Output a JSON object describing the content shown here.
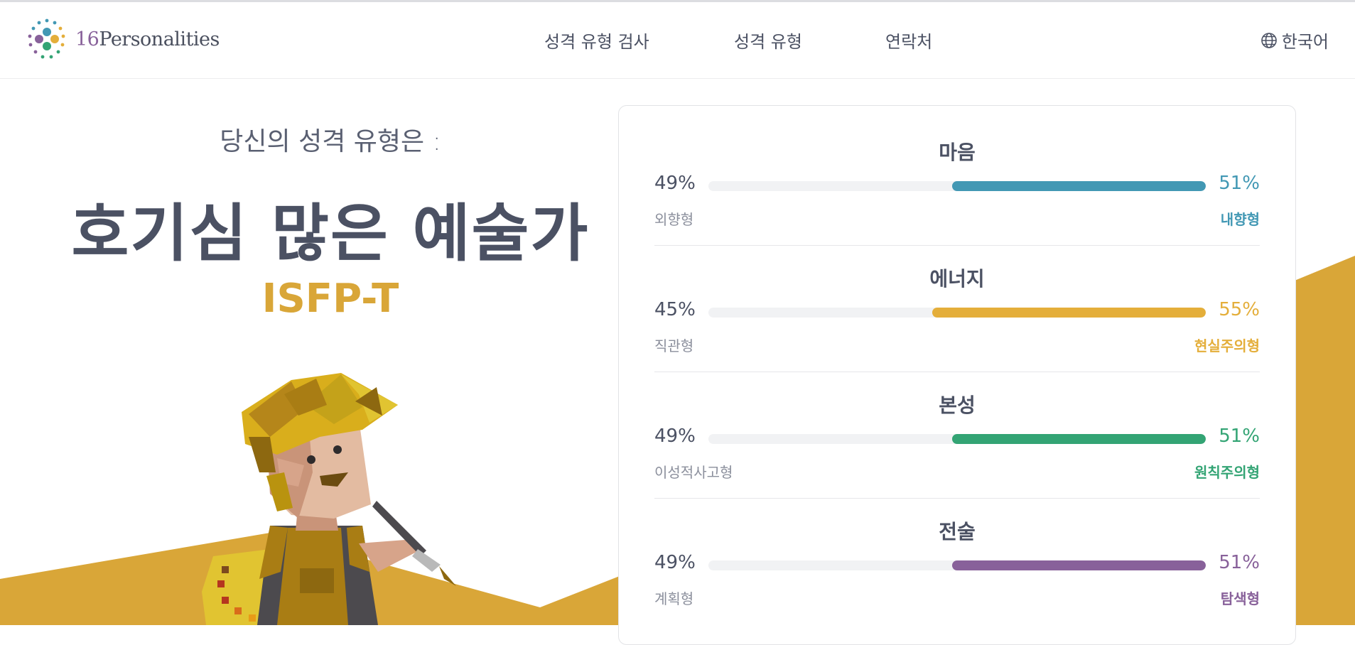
{
  "brand": {
    "number": "16",
    "name": "Personalities"
  },
  "nav": {
    "items": [
      "성격 유형 검사",
      "성격 유형",
      "연락처"
    ]
  },
  "language": "한국어",
  "result": {
    "intro": "당신의 성격 유형은 :",
    "type_name": "호기심 많은 예술가",
    "type_code": "ISFP-T"
  },
  "traits": [
    {
      "title": "마음",
      "left_percent": "49%",
      "right_percent": "51%",
      "left_label": "외향형",
      "right_label": "내향형",
      "fill_fraction": 0.51,
      "color": "#4298b4"
    },
    {
      "title": "에너지",
      "left_percent": "45%",
      "right_percent": "55%",
      "left_label": "직관형",
      "right_label": "현실주의형",
      "fill_fraction": 0.55,
      "color": "#e4ae3a"
    },
    {
      "title": "본성",
      "left_percent": "49%",
      "right_percent": "51%",
      "left_label": "이성적사고형",
      "right_label": "원칙주의형",
      "fill_fraction": 0.51,
      "color": "#33a474"
    },
    {
      "title": "전술",
      "left_percent": "49%",
      "right_percent": "51%",
      "left_label": "계획형",
      "right_label": "탐색형",
      "fill_fraction": 0.51,
      "color": "#88619a"
    }
  ],
  "colors": {
    "accent_gold": "#d9a638",
    "text": "#4b5163"
  },
  "icons": {
    "logo": "logo-dots-icon",
    "language": "globe-icon"
  }
}
